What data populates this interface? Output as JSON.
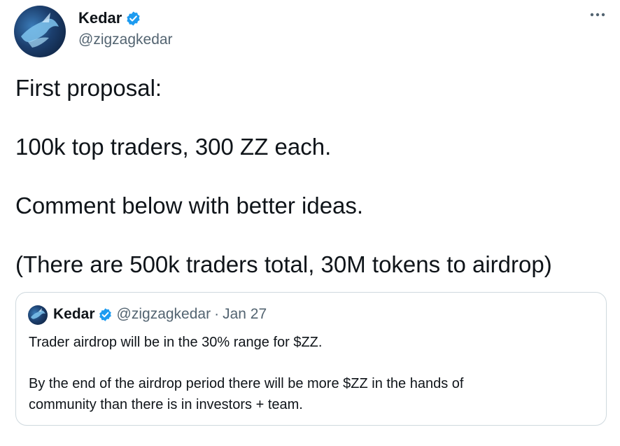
{
  "author": {
    "name": "Kedar",
    "handle": "@zigzagkedar"
  },
  "more_icon": "more-horizontal-icon",
  "tweet_lines": [
    "First proposal:",
    "100k top traders, 300 ZZ each.",
    "Comment below with better ideas.",
    "(There are 500k traders total, 30M tokens to airdrop)"
  ],
  "quote": {
    "name": "Kedar",
    "handle": "@zigzagkedar",
    "separator": "·",
    "date": "Jan 27",
    "lines": [
      "Trader airdrop will be in the 30% range for $ZZ.",
      "By the end of the airdrop period there will be more $ZZ in the hands of",
      "community than there is in investors + team."
    ]
  },
  "colors": {
    "verified_blue": "#1d9bf0",
    "secondary_text": "#536471",
    "border": "#cfd9de"
  }
}
